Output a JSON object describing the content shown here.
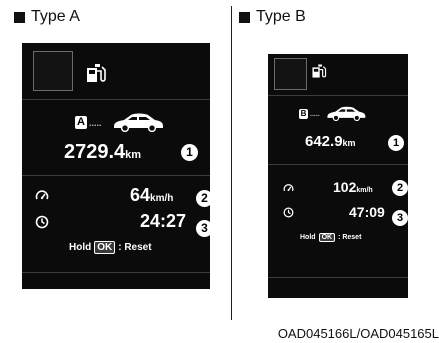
{
  "typeA": {
    "heading": "Type A",
    "mode_letter": "A",
    "distance_value": "2729.4",
    "distance_unit": "km",
    "speed_value": "64",
    "speed_unit": "km/h",
    "time_value": "24:27",
    "hold_text": "Hold",
    "ok_key": "OK",
    "reset_text": ": Reset",
    "callouts": [
      "1",
      "2",
      "3"
    ]
  },
  "typeB": {
    "heading": "Type B",
    "mode_letter": "B",
    "distance_value": "642.9",
    "distance_unit": "km",
    "speed_value": "102",
    "speed_unit": "km/h",
    "time_value": "47:09",
    "hold_text": "Hold",
    "ok_key": "OK",
    "reset_text": ": Reset",
    "callouts": [
      "1",
      "2",
      "3"
    ]
  },
  "figure_code": "OAD045166L/OAD045165L",
  "icons": {
    "fuel": "fuel-pump-icon",
    "car": "car-icon",
    "speed": "speedometer-icon",
    "time": "clock-icon"
  }
}
